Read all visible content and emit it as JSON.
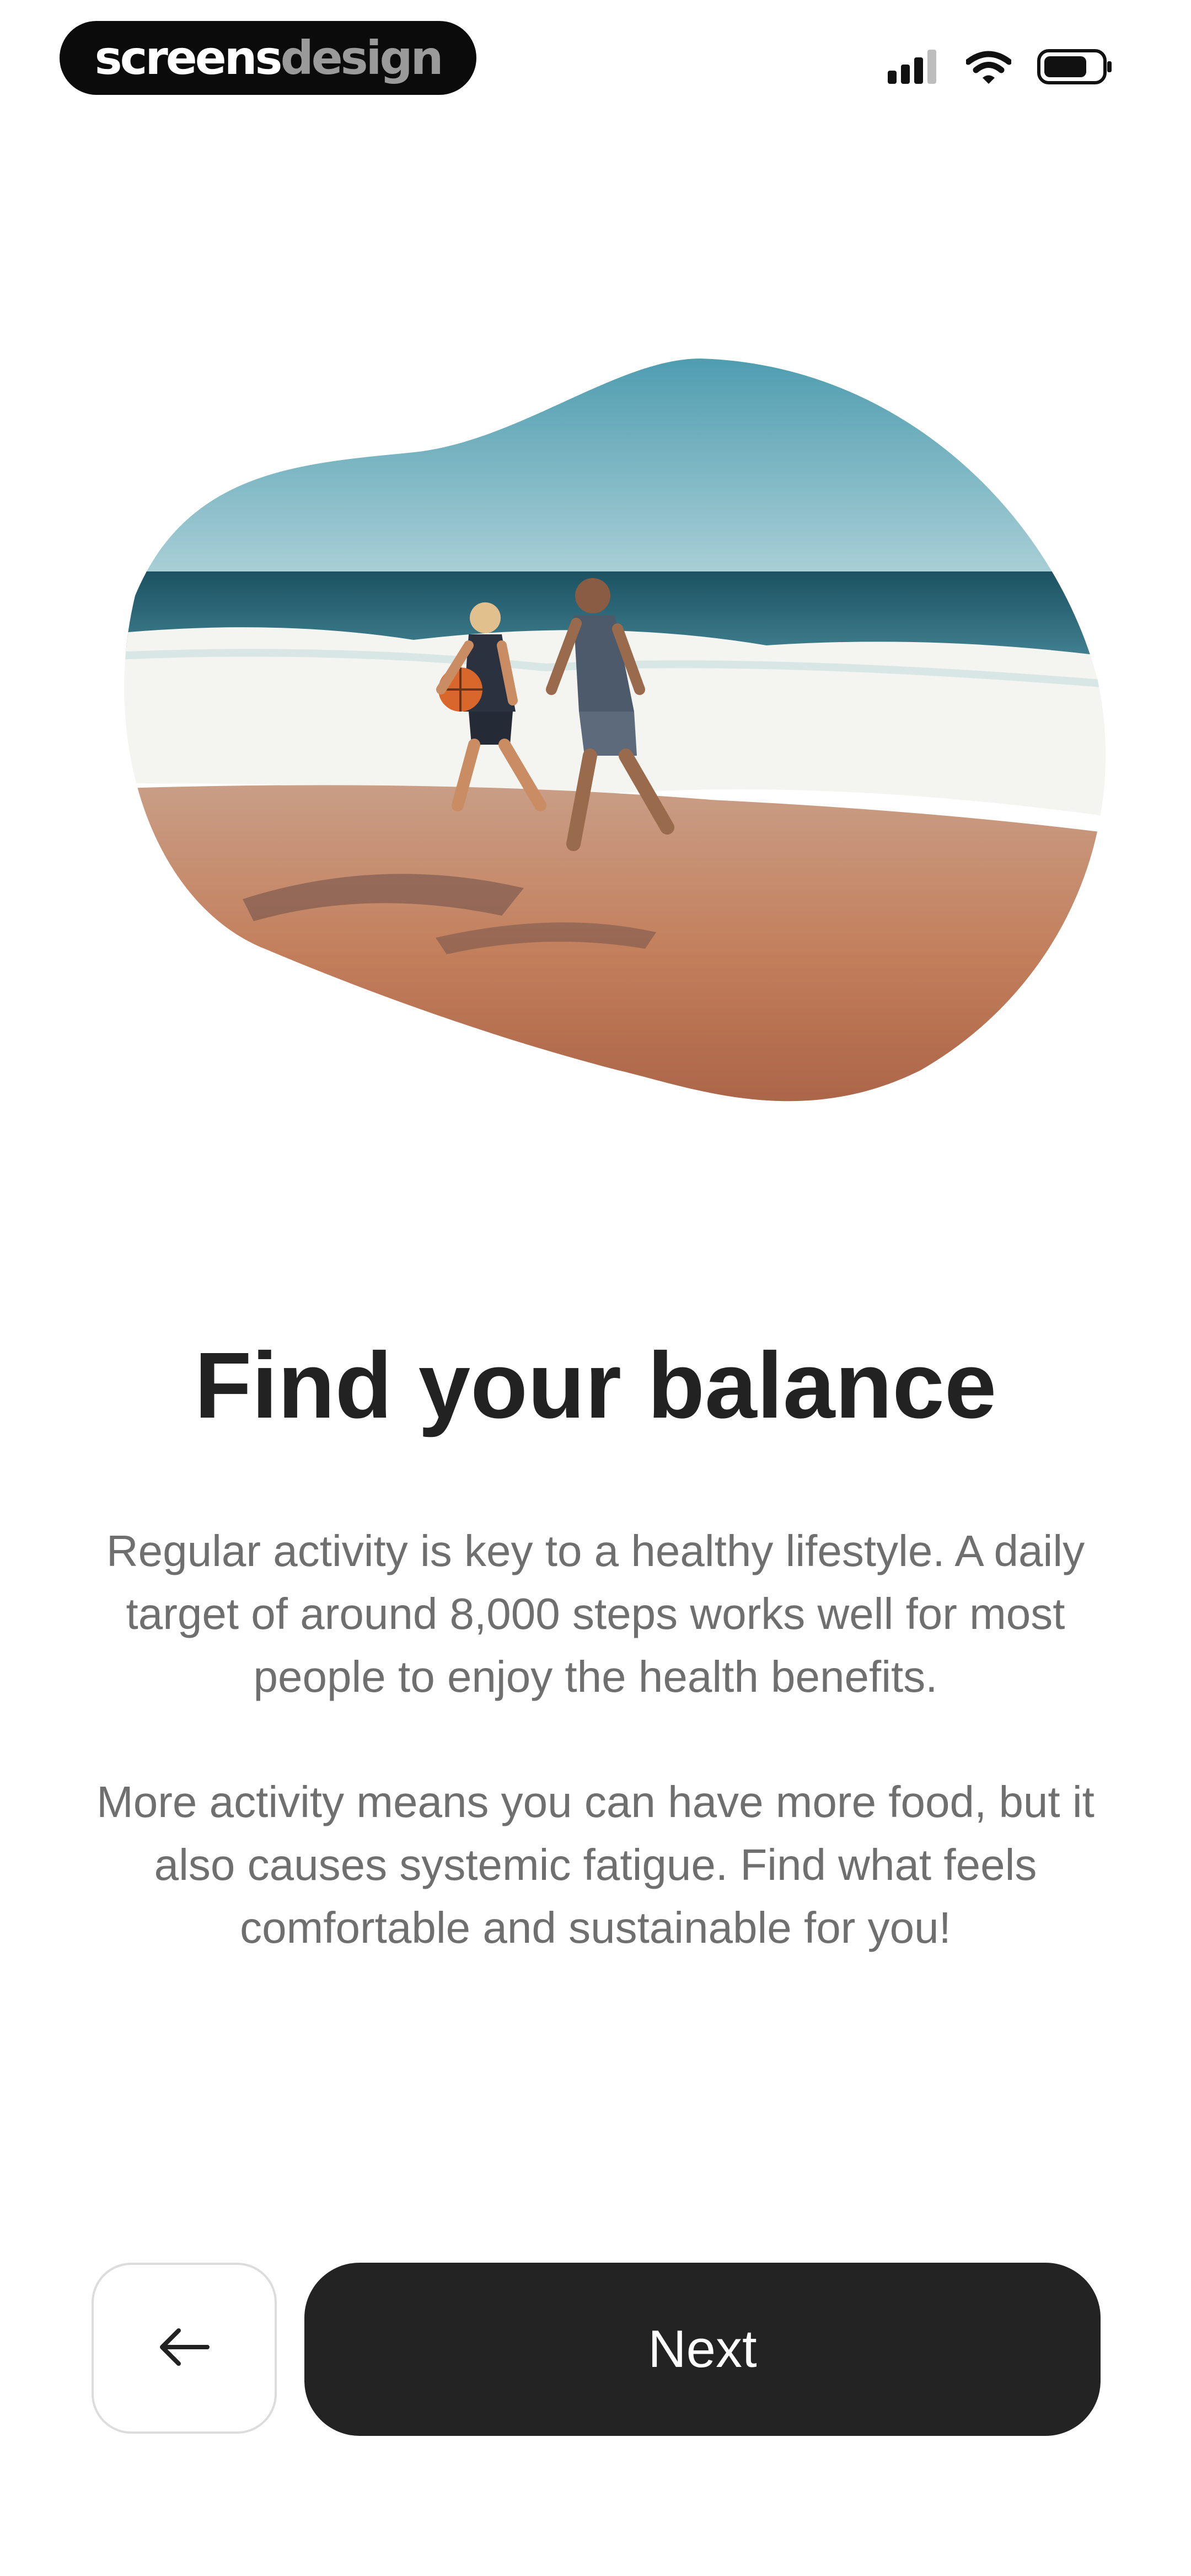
{
  "watermark": {
    "part1": "screens",
    "part2": "design"
  },
  "status_bar": {
    "signal_icon": "cellular-signal-icon",
    "wifi_icon": "wifi-icon",
    "battery_icon": "battery-icon"
  },
  "hero": {
    "image_subject": "beach-photo"
  },
  "title": "Find your balance",
  "paragraphs": [
    "Regular activity is key to a healthy lifestyle. A daily target of around 8,000 steps works well for most people to enjoy the health benefits.",
    "More activity means you can have more food, but it also causes systemic fatigue. Find what feels comfortable and sustainable for you!"
  ],
  "buttons": {
    "back_icon": "arrow-left-icon",
    "next_label": "Next"
  },
  "colors": {
    "primary": "#232323",
    "text_body": "#6f6f6f",
    "title": "#222222",
    "background": "#ffffff"
  }
}
